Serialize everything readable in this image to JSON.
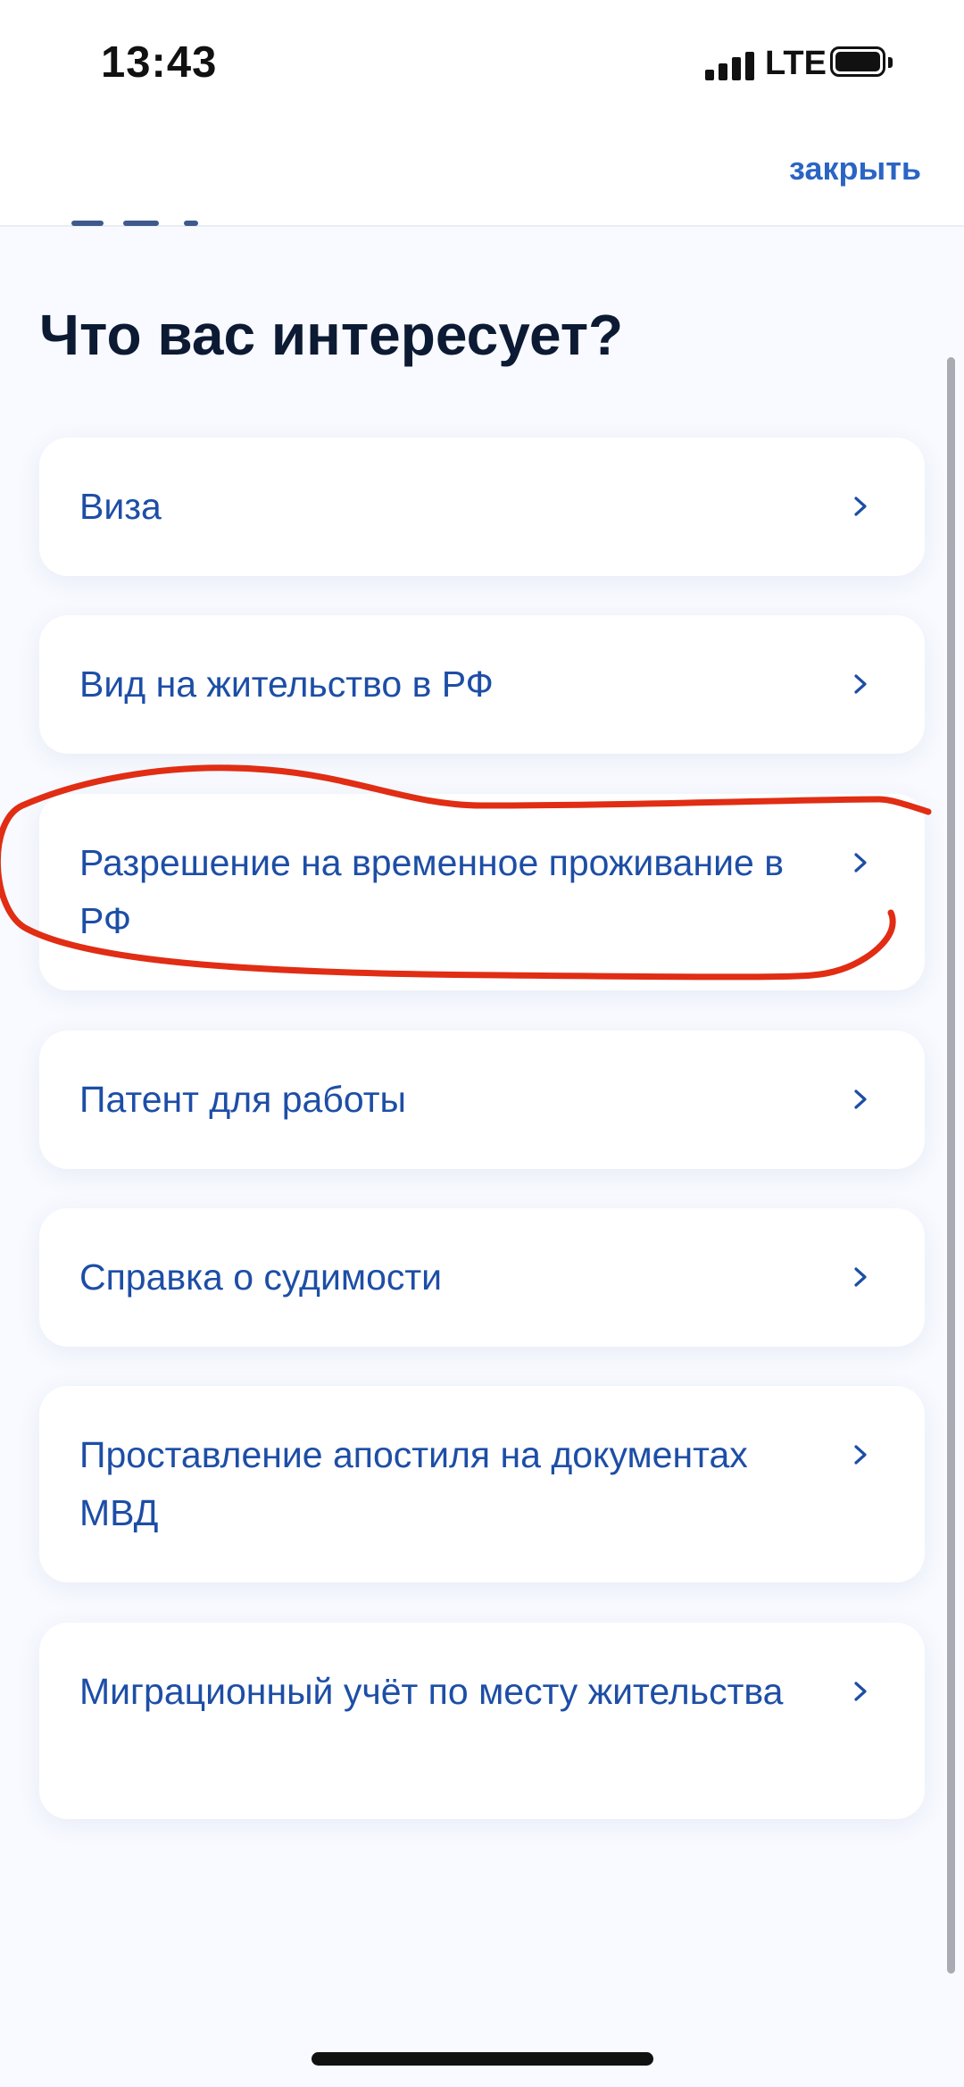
{
  "status_bar": {
    "time": "13:43",
    "network": "LTE",
    "icons": [
      "signal-icon",
      "battery-icon"
    ]
  },
  "header": {
    "close_label": "закрыть"
  },
  "page_title": "Что вас интересует?",
  "options": [
    {
      "label": "Виза",
      "icon": "chevron-right-icon"
    },
    {
      "label": "Вид на жительство в РФ",
      "icon": "chevron-right-icon"
    },
    {
      "label": "Разрешение на временное проживание в РФ",
      "icon": "chevron-right-icon",
      "annotated": true
    },
    {
      "label": "Патент для работы",
      "icon": "chevron-right-icon"
    },
    {
      "label": "Справка о судимости",
      "icon": "chevron-right-icon"
    },
    {
      "label": "Проставление апостиля на документах МВД",
      "icon": "chevron-right-icon"
    },
    {
      "label": "Миграционный учёт по месту жительства",
      "icon": "chevron-right-icon"
    }
  ],
  "colors": {
    "accent": "#2b65c4",
    "card_text": "#1d4ea6",
    "title_text": "#0c1a33",
    "background": "#f8faff",
    "annotation": "#e02d14"
  }
}
